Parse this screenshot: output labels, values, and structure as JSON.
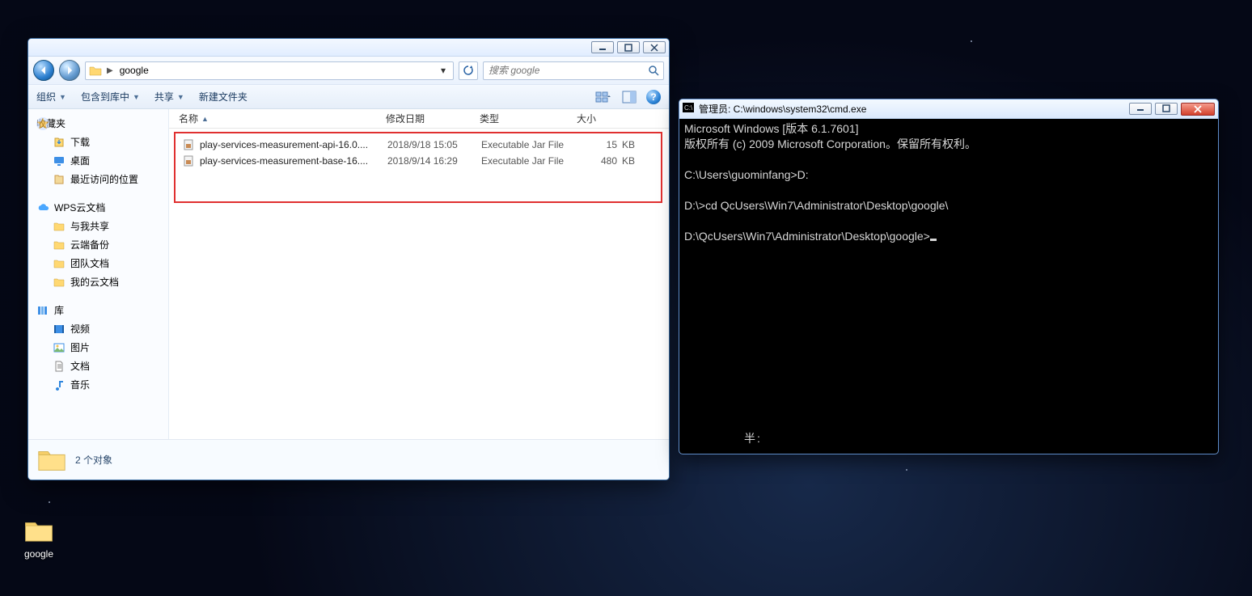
{
  "explorer": {
    "breadcrumb_folder": "google",
    "search_placeholder": "搜索 google",
    "toolbar": {
      "organize": "组织",
      "include": "包含到库中",
      "share": "共享",
      "newfolder": "新建文件夹"
    },
    "sidebar": {
      "favorites": "收藏夹",
      "downloads": "下载",
      "desktop": "桌面",
      "recent": "最近访问的位置",
      "wps": "WPS云文档",
      "wps_share": "与我共享",
      "wps_backup": "云端备份",
      "wps_team": "团队文档",
      "wps_my": "我的云文档",
      "libraries": "库",
      "videos": "视频",
      "pictures": "图片",
      "documents": "文档",
      "music": "音乐"
    },
    "columns": {
      "name": "名称",
      "date": "修改日期",
      "type": "类型",
      "size": "大小"
    },
    "rows": [
      {
        "name": "play-services-measurement-api-16.0....",
        "date": "2018/9/18 15:05",
        "type": "Executable Jar File",
        "size": "15",
        "unit": "KB"
      },
      {
        "name": "play-services-measurement-base-16....",
        "date": "2018/9/14 16:29",
        "type": "Executable Jar File",
        "size": "480",
        "unit": "KB"
      }
    ],
    "status_count": "2 个对象"
  },
  "cmd": {
    "title": "管理员: C:\\windows\\system32\\cmd.exe",
    "lines": [
      "Microsoft Windows [版本 6.1.7601]",
      "版权所有 (c) 2009 Microsoft Corporation。保留所有权利。",
      "",
      "C:\\Users\\guominfang>D:",
      "",
      "D:\\>cd QcUsers\\Win7\\Administrator\\Desktop\\google\\",
      "",
      "D:\\QcUsers\\Win7\\Administrator\\Desktop\\google>"
    ],
    "ime": "半:"
  },
  "desktop": {
    "folder_label": "google"
  }
}
